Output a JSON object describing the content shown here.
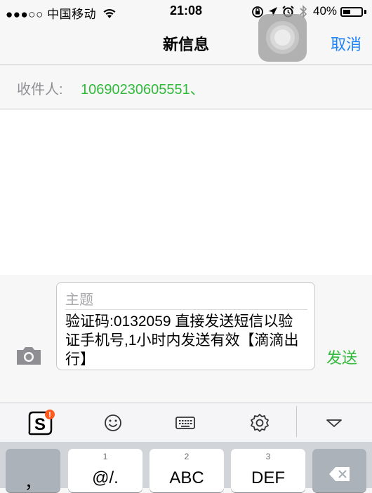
{
  "status_bar": {
    "carrier": "●●●○○ 中国移动",
    "time": "21:08",
    "battery": "40%",
    "battery_level": 0.4
  },
  "nav": {
    "title": "新信息",
    "cancel": "取消"
  },
  "recipients": {
    "label": "收件人:",
    "value": "10690230605551、"
  },
  "compose": {
    "subject_placeholder": "主题",
    "body": "验证码:0132059 直接发送短信以验证手机号,1小时内发送有效【滴滴出行】",
    "send": "发送"
  },
  "keyboard": {
    "keys": [
      {
        "num": "",
        "label": "，"
      },
      {
        "num": "1",
        "label": "@/."
      },
      {
        "num": "2",
        "label": "ABC"
      },
      {
        "num": "3",
        "label": "DEF"
      }
    ]
  },
  "colors": {
    "accent_blue": "#1a82fb",
    "accent_green": "#31b93b",
    "badge_orange": "#ff5a1f"
  }
}
